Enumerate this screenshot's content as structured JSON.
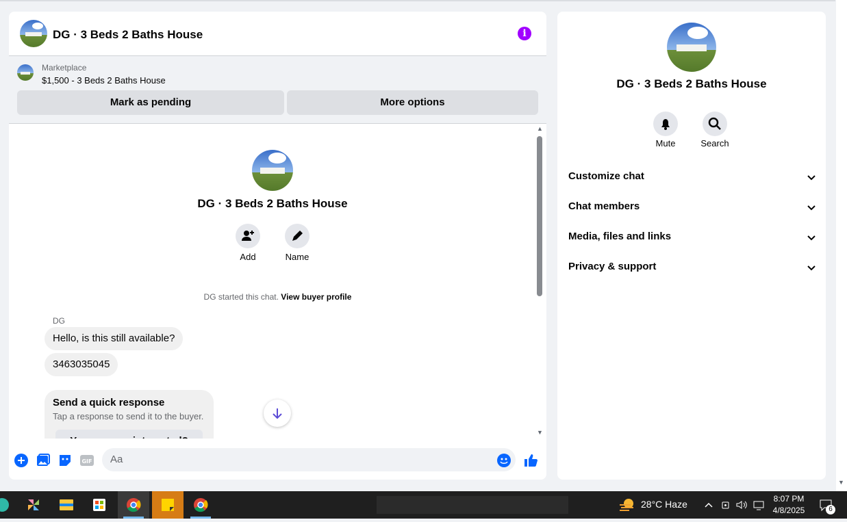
{
  "header": {
    "title": "DG · 3 Beds 2 Baths House"
  },
  "listing": {
    "label": "Marketplace",
    "item": "$1,500 - 3 Beds 2 Baths House",
    "pending_button": "Mark as pending",
    "more_button": "More options"
  },
  "conversation": {
    "title": "DG · 3 Beds 2 Baths House",
    "add_label": "Add",
    "name_label": "Name",
    "started_text": "DG started this chat.",
    "buyer_link": "View buyer profile",
    "sender": "DG",
    "messages": [
      "Hello, is this still available?",
      "3463035045"
    ],
    "quick_title": "Send a quick response",
    "quick_subtitle": "Tap a response to send it to the buyer.",
    "quick_option": "Yes, are you interested?"
  },
  "composer": {
    "placeholder": "Aa"
  },
  "side": {
    "title": "DG · 3 Beds 2 Baths House",
    "mute_label": "Mute",
    "search_label": "Search",
    "sections": [
      "Customize chat",
      "Chat members",
      "Media, files and links",
      "Privacy & support"
    ]
  },
  "taskbar": {
    "weather": "28°C  Haze",
    "time": "8:07 PM",
    "date": "4/8/2025",
    "notifications": "6"
  },
  "colors": {
    "accent": "#0866ff",
    "info": "#a100ff",
    "taskbar": "#1f1f1f"
  }
}
